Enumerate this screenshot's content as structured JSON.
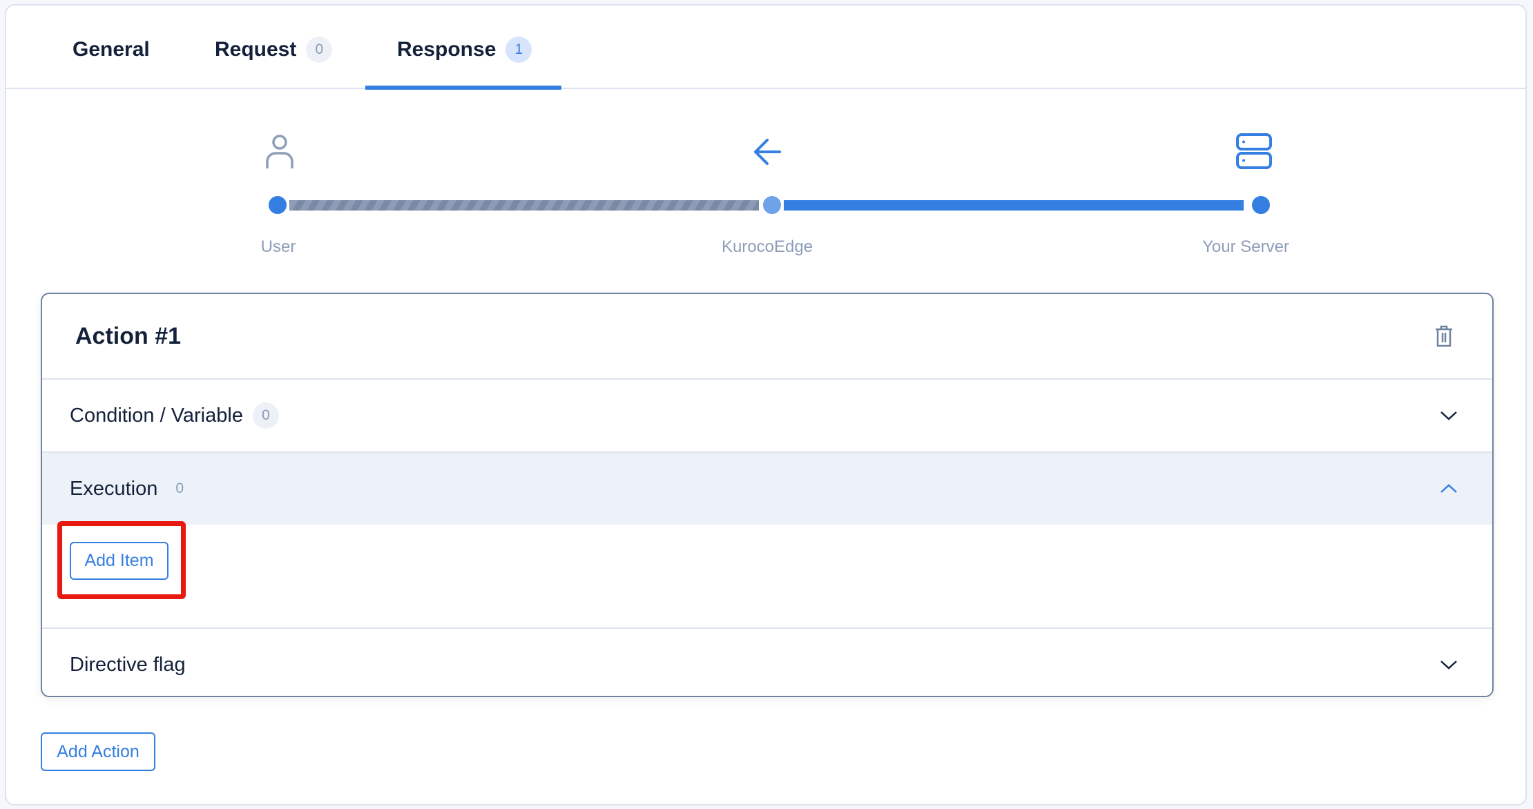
{
  "tabs": [
    {
      "label": "General"
    },
    {
      "label": "Request",
      "count": "0"
    },
    {
      "label": "Response",
      "count": "1",
      "active": true
    }
  ],
  "flow": {
    "nodes": [
      {
        "label": "User",
        "icon": "user-icon"
      },
      {
        "label": "KurocoEdge",
        "icon": "arrow-left-icon"
      },
      {
        "label": "Your Server",
        "icon": "server-icon"
      }
    ],
    "colors": {
      "active": "#347fe1",
      "inactive_stripe": "#7a8aa6"
    }
  },
  "action": {
    "title": "Action #1",
    "sections": [
      {
        "label": "Condition / Variable",
        "count": "0",
        "expanded": false
      },
      {
        "label": "Execution",
        "count": "0",
        "expanded": true
      },
      {
        "label": "Directive flag",
        "expanded": false
      }
    ],
    "add_item_label": "Add Item"
  },
  "add_action_label": "Add Action",
  "highlight_color": "#e8190f"
}
